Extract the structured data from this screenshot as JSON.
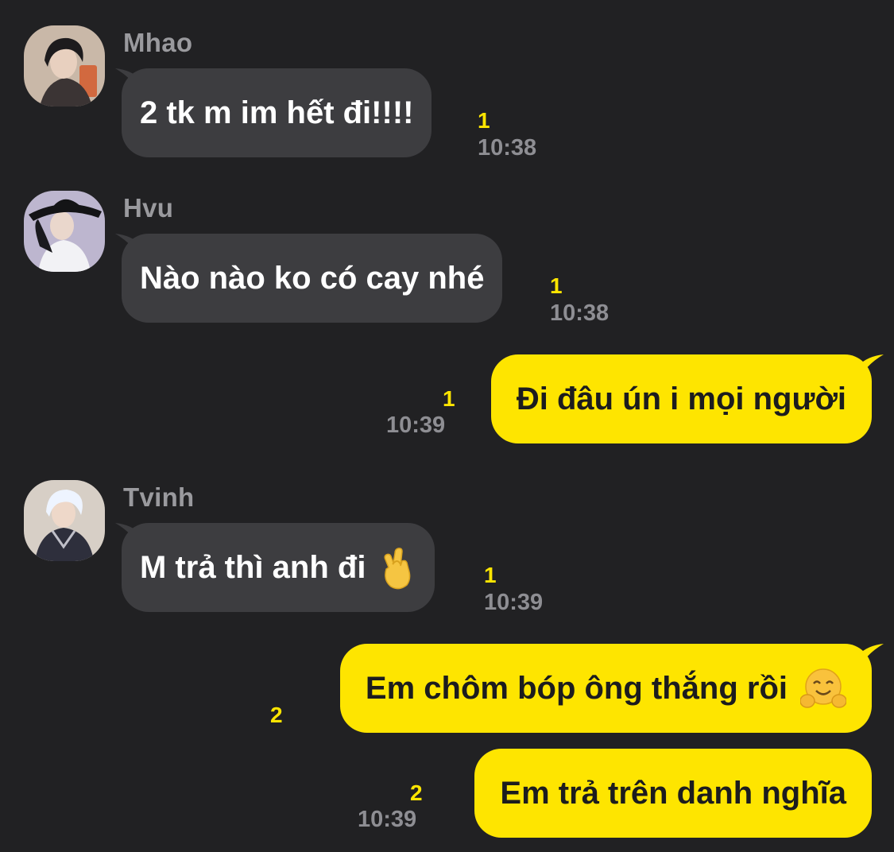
{
  "colors": {
    "background": "#212123",
    "incoming_bubble": "#3d3d40",
    "outgoing_bubble": "#fee500",
    "unread_count": "#fee500",
    "timestamp": "#8e8e93",
    "sender_name": "#9a9a9e"
  },
  "messages": [
    {
      "direction": "incoming",
      "sender": "Mhao",
      "text": "2 tk m im hết đi!!!!",
      "unread": "1",
      "time": "10:38"
    },
    {
      "direction": "incoming",
      "sender": "Hvu",
      "text": "Nào nào ko có cay nhé",
      "unread": "1",
      "time": "10:38"
    },
    {
      "direction": "outgoing",
      "text": "Đi đâu ún i mọi người",
      "unread": "1",
      "time": "10:39"
    },
    {
      "direction": "incoming",
      "sender": "Tvinh",
      "text": "M trả thì anh đi",
      "emoji": "crossed-fingers-emoji",
      "unread": "1",
      "time": "10:39"
    },
    {
      "direction": "outgoing",
      "text": "Em chôm bóp ông thắng rồi",
      "emoji": "hugging-face-emoji",
      "unread": "2"
    },
    {
      "direction": "outgoing",
      "text": "Em trả trên danh nghĩa",
      "unread": "2",
      "time": "10:39"
    }
  ]
}
